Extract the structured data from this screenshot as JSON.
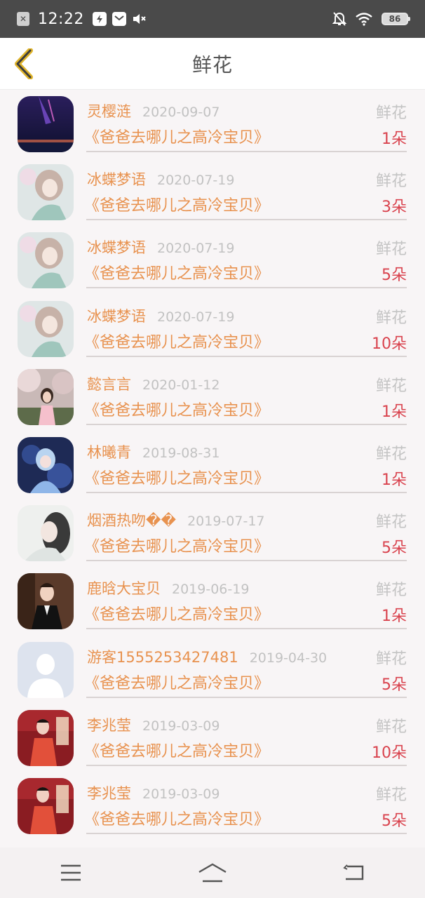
{
  "status_bar": {
    "time": "12:22",
    "battery": "86",
    "icons": [
      "x-square-icon",
      "app-bolt-icon",
      "mail-icon",
      "mute-icon",
      "bell-off-icon",
      "wifi-icon",
      "battery-icon"
    ]
  },
  "header": {
    "title": "鲜花",
    "back_icon": "chevron-left-icon",
    "accent_color": "#e0b42a"
  },
  "colors": {
    "name": "#e8924f",
    "date": "#c2c2c2",
    "type": "#c4c4c4",
    "count": "#d9434e"
  },
  "list": [
    {
      "name": "灵樱涟",
      "date": "2020-09-07",
      "type": "鲜花",
      "book": "《爸爸去哪儿之高冷宝贝》",
      "count": "1朵",
      "avatar": "night-sky-avatar"
    },
    {
      "name": "冰蝶梦语",
      "date": "2020-07-19",
      "type": "鲜花",
      "book": "《爸爸去哪儿之高冷宝贝》",
      "count": "3朵",
      "avatar": "anime-girl-avatar"
    },
    {
      "name": "冰蝶梦语",
      "date": "2020-07-19",
      "type": "鲜花",
      "book": "《爸爸去哪儿之高冷宝贝》",
      "count": "5朵",
      "avatar": "anime-girl-avatar"
    },
    {
      "name": "冰蝶梦语",
      "date": "2020-07-19",
      "type": "鲜花",
      "book": "《爸爸去哪儿之高冷宝贝》",
      "count": "10朵",
      "avatar": "anime-girl-avatar"
    },
    {
      "name": "懿言言",
      "date": "2020-01-12",
      "type": "鲜花",
      "book": "《爸爸去哪儿之高冷宝贝》",
      "count": "1朵",
      "avatar": "girl-blossom-avatar"
    },
    {
      "name": "林曦青",
      "date": "2019-08-31",
      "type": "鲜花",
      "book": "《爸爸去哪儿之高冷宝贝》",
      "count": "1朵",
      "avatar": "anime-blue-avatar"
    },
    {
      "name": "烟酒热吻��",
      "date": "2019-07-17",
      "type": "鲜花",
      "book": "《爸爸去哪儿之高冷宝贝》",
      "count": "5朵",
      "avatar": "pale-girl-avatar"
    },
    {
      "name": "鹿晗大宝贝",
      "date": "2019-06-19",
      "type": "鲜花",
      "book": "《爸爸去哪儿之高冷宝贝》",
      "count": "1朵",
      "avatar": "man-suit-avatar"
    },
    {
      "name": "游客1555253427481",
      "date": "2019-04-30",
      "type": "鲜花",
      "book": "《爸爸去哪儿之高冷宝贝》",
      "count": "5朵",
      "avatar": "default-user-avatar"
    },
    {
      "name": "李兆莹",
      "date": "2019-03-09",
      "type": "鲜花",
      "book": "《爸爸去哪儿之高冷宝贝》",
      "count": "10朵",
      "avatar": "red-poster-avatar"
    },
    {
      "name": "李兆莹",
      "date": "2019-03-09",
      "type": "鲜花",
      "book": "《爸爸去哪儿之高冷宝贝》",
      "count": "5朵",
      "avatar": "red-poster-avatar"
    }
  ],
  "nav_bar": {
    "icons": [
      "menu-icon",
      "home-icon",
      "back-icon"
    ]
  }
}
